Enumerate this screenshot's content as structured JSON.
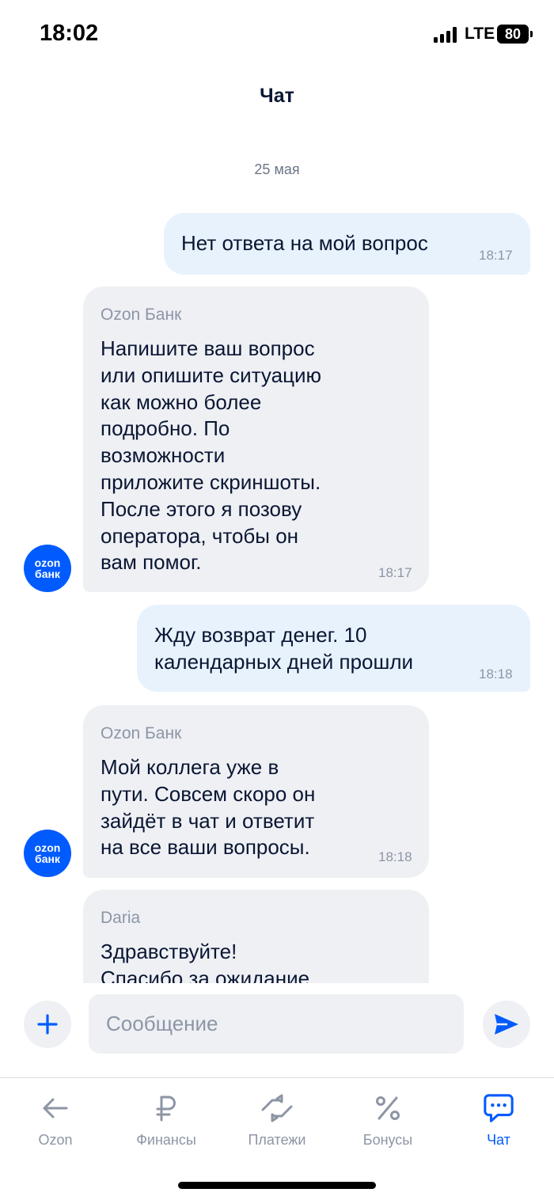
{
  "status_bar": {
    "time": "18:02",
    "network": "LTE",
    "battery": "80"
  },
  "header": {
    "title": "Чат"
  },
  "chat": {
    "date": "25 мая",
    "messages": [
      {
        "direction": "out",
        "text": "Нет ответа на мой вопрос",
        "time": "18:17"
      },
      {
        "direction": "in",
        "sender": "Ozon Банк",
        "text": "Напишите ваш вопрос\nили опишите ситуацию\nкак можно более\nподробно. По\nвозможности\nприложите скриншоты.\nПосле этого я позову\nоператора, чтобы он\nвам помог.",
        "time": "18:17"
      },
      {
        "direction": "out",
        "text": "Жду возврат денег. 10\nкалендарных дней прошли",
        "time": "18:18"
      },
      {
        "direction": "in",
        "sender": "Ozon Банк",
        "text": "Мой коллега уже в\nпути. Совсем скоро он\nзайдёт в чат и ответит\nна все ваши вопросы.",
        "time": "18:18"
      },
      {
        "direction": "in",
        "sender": "Daria",
        "text": "Здравствуйте!\nСпасибо за ожидание."
      }
    ],
    "avatar": {
      "line1": "ozon",
      "line2": "банк"
    }
  },
  "composer": {
    "placeholder": "Сообщение"
  },
  "tabbar": {
    "items": [
      {
        "label": "Ozon",
        "icon": "arrow-left-icon"
      },
      {
        "label": "Финансы",
        "icon": "ruble-icon"
      },
      {
        "label": "Платежи",
        "icon": "transfer-arrows-icon"
      },
      {
        "label": "Бонусы",
        "icon": "percent-icon"
      },
      {
        "label": "Чат",
        "icon": "chat-bubble-icon",
        "active": true
      }
    ]
  },
  "colors": {
    "accent": "#005bff",
    "bubble_out": "#e8f2fd",
    "bubble_in": "#eef0f4",
    "text": "#0a1633",
    "muted": "#8d95a5"
  }
}
